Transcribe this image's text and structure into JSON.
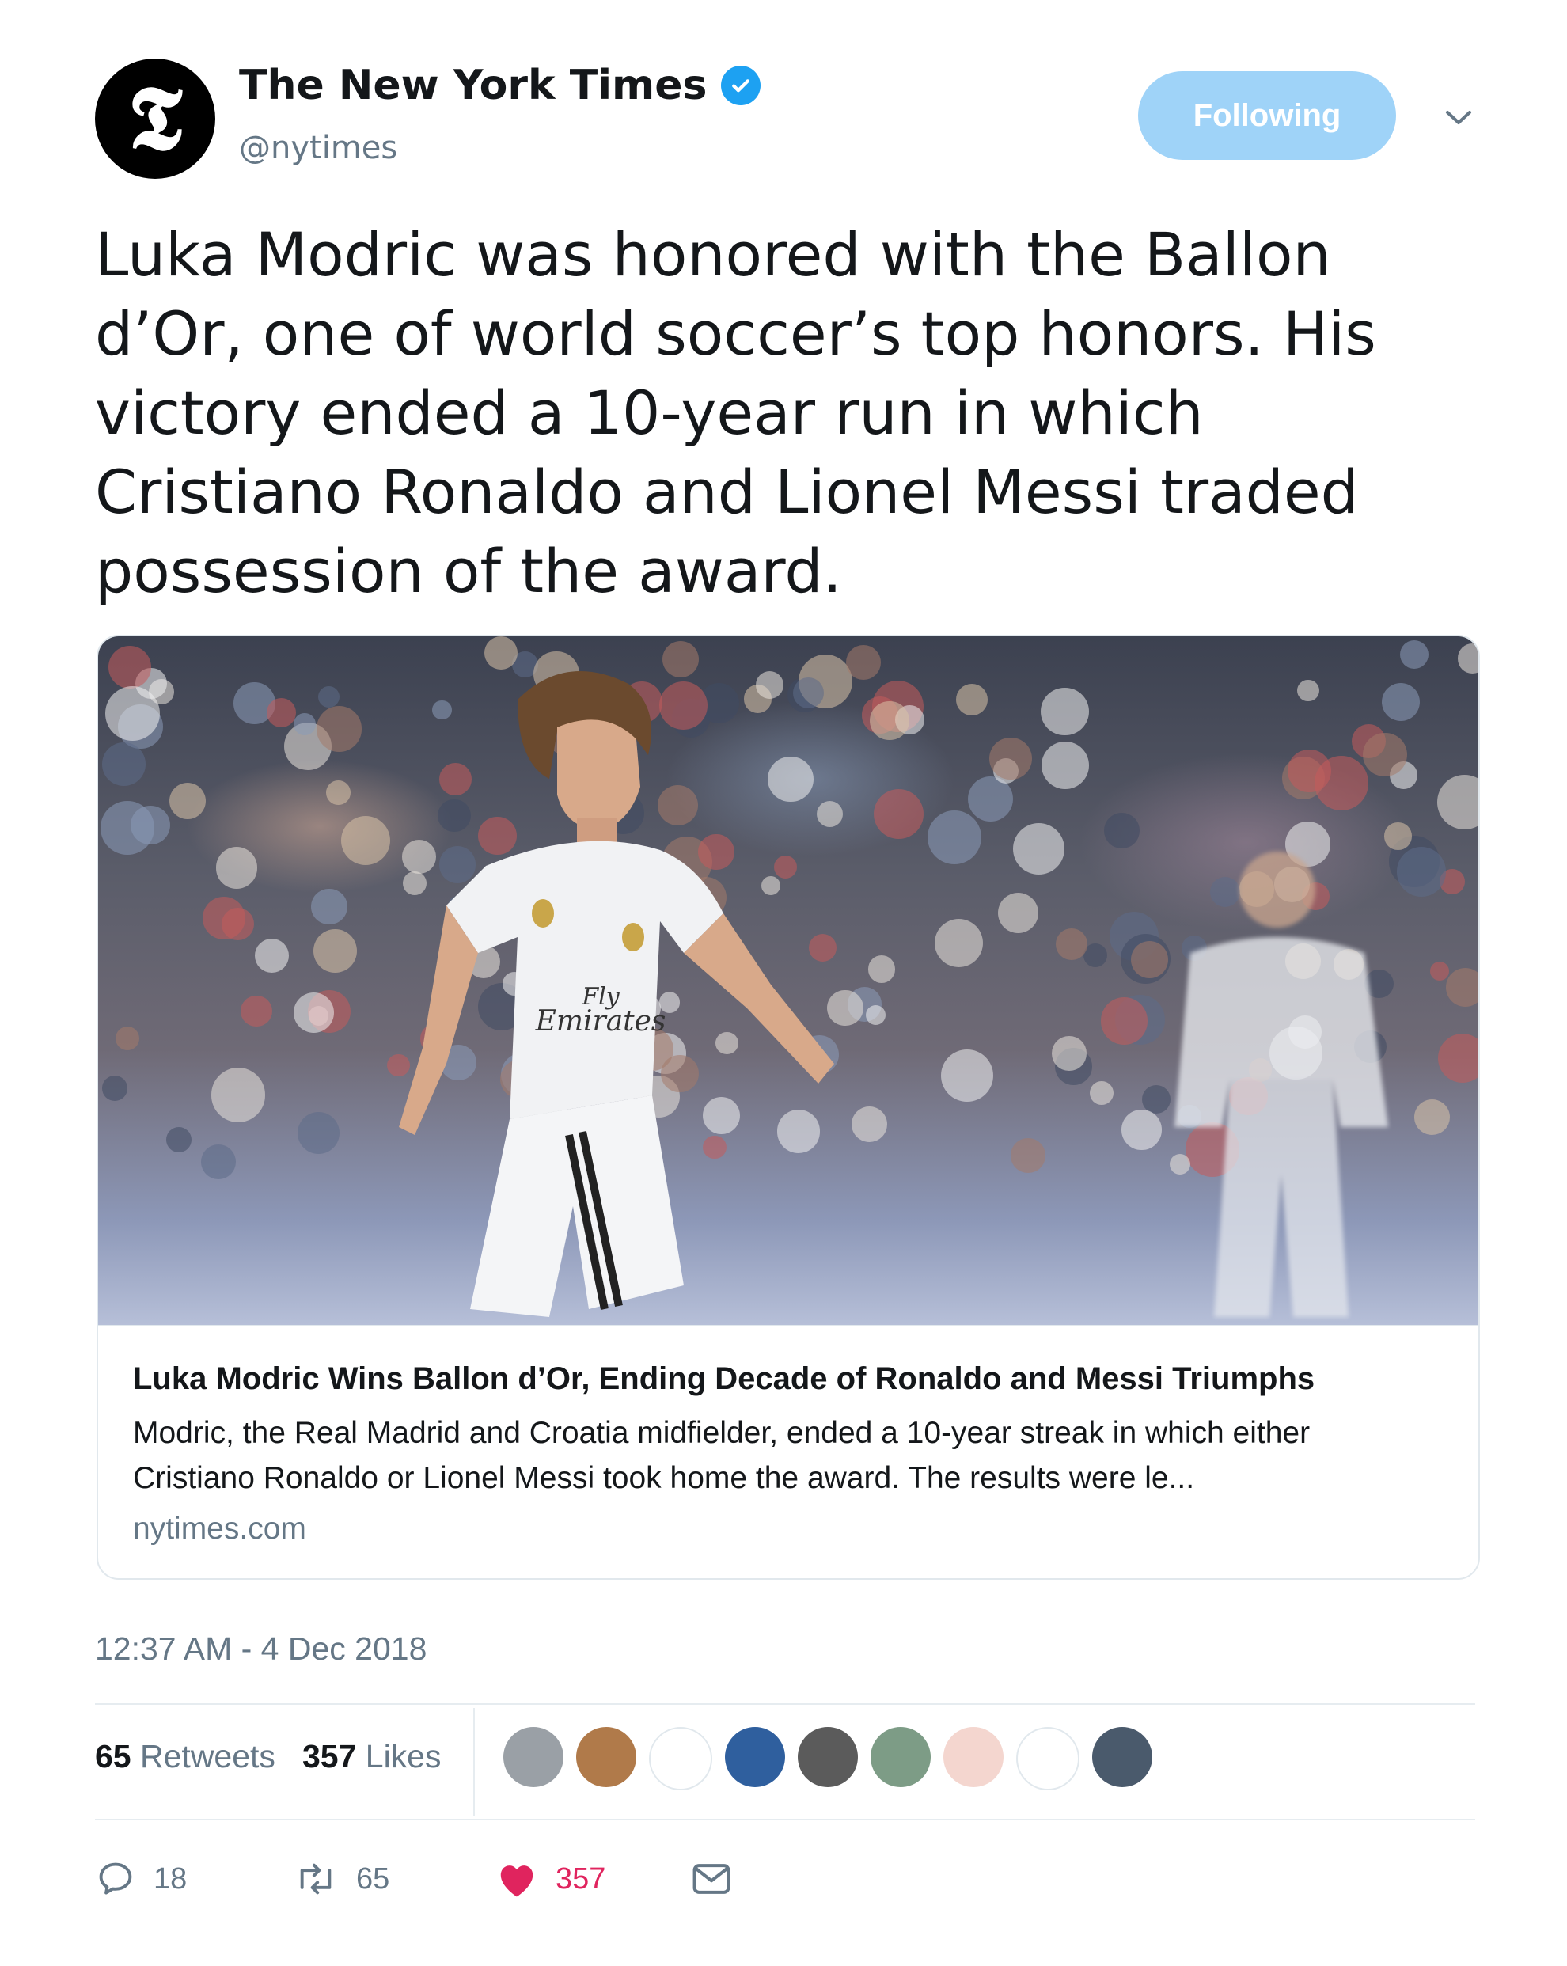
{
  "header": {
    "logo_glyph": "𝕿",
    "display_name": "The New York Times",
    "handle": "@nytimes",
    "follow_button_label": "Following",
    "verified": true
  },
  "tweet": {
    "text": "Luka Modric was honored with the Ballon d’Or, one of world soccer’s top honors. His victory ended a 10-year run in which Cristiano Ronaldo and Lionel Messi traded possession of the award."
  },
  "card": {
    "image_icon": "soccer-player-photo",
    "jersey_text_1": "Fly",
    "jersey_text_2": "Emirates",
    "title": "Luka Modric Wins Ballon d’Or, Ending Decade of Ronaldo and Messi Triumphs",
    "description": "Modric, the Real Madrid and Croatia midfielder, ended a 10-year streak in which either Cristiano Ronaldo or Lionel Messi took home the award. The results were le...",
    "domain": "nytimes.com"
  },
  "timestamp": "12:37 AM - 4 Dec 2018",
  "stats": {
    "retweets_count": "65",
    "retweets_label": "Retweets",
    "likes_count": "357",
    "likes_label": "Likes"
  },
  "avatars": [
    {
      "name": "avatar-1",
      "color": "#9aa0a6"
    },
    {
      "name": "avatar-2",
      "color": "#b07a4a"
    },
    {
      "name": "avatar-3",
      "color": "#ffffff"
    },
    {
      "name": "avatar-4",
      "color": "#2f5f9e"
    },
    {
      "name": "avatar-5",
      "color": "#5b5b5b"
    },
    {
      "name": "avatar-6",
      "color": "#7d9c86"
    },
    {
      "name": "avatar-7",
      "color": "#f4d6cf"
    },
    {
      "name": "avatar-8",
      "color": "#ffffff"
    },
    {
      "name": "avatar-9",
      "color": "#4a5a6c"
    }
  ],
  "actions": {
    "reply_count": "18",
    "retweet_count": "65",
    "like_count": "357"
  },
  "colors": {
    "accent": "#1da1f2",
    "follow_button": "#9fd3f8",
    "like": "#e0245e",
    "secondary_text": "#657786"
  }
}
